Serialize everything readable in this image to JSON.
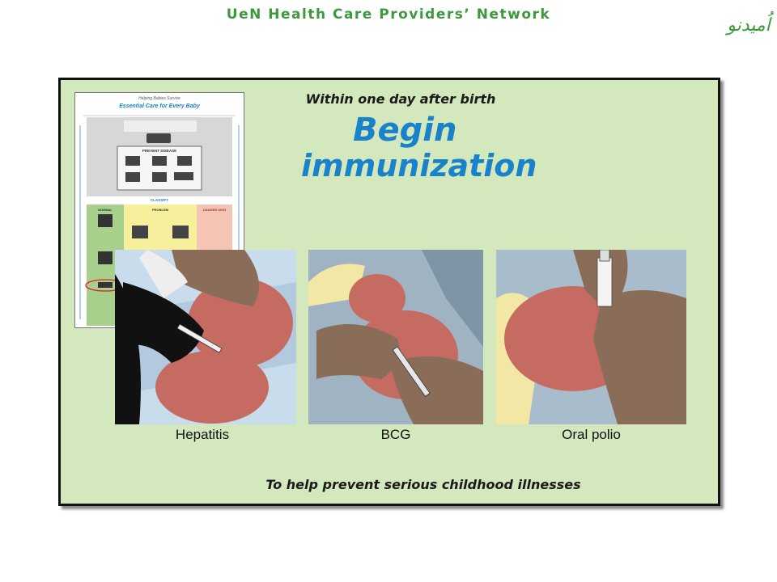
{
  "header": {
    "network_name": "UeN Health Care Providers’ Network"
  },
  "logo": {
    "text": "اُمیدنو"
  },
  "slide": {
    "subtitle": "Within one day after birth",
    "title_line1": "Begin",
    "title_line2": "immunization",
    "footer": "To help prevent serious childhood illnesses"
  },
  "chart_thumbnail": {
    "top_label": "Helping Babies Survive",
    "title": "Essential Care for Every Baby",
    "section_prevent": "PREVENT DISEASE",
    "section_classify": "CLASSIFY",
    "col_normal": "NORMAL",
    "col_problem": "PROBLEM",
    "col_danger": "DANGER SIGN"
  },
  "images": [
    {
      "caption": "Hepatitis"
    },
    {
      "caption": "BCG"
    },
    {
      "caption": "Oral polio"
    }
  ],
  "colors": {
    "header_green": "#3c9a3c",
    "title_blue": "#1a82c8",
    "panel_green": "#d4e8be"
  }
}
